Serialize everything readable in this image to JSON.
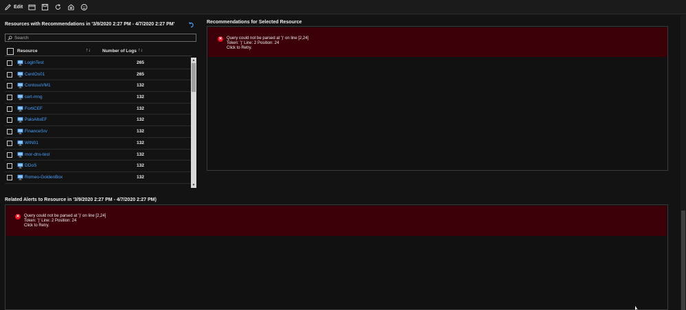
{
  "toolbar": {
    "edit_label": "Edit",
    "icons": [
      "edit-icon",
      "open-icon",
      "save-icon",
      "refresh-icon",
      "clone-icon",
      "feedback-icon"
    ]
  },
  "resources_panel": {
    "title": "Resources with Recommendations in '3/9/2020 2:27 PM - 4/7/2020 2:27 PM'",
    "search_placeholder": "Search",
    "columns": {
      "resource": "Resource",
      "logs": "Number of Logs"
    },
    "rows": [
      {
        "name": "LoginTest",
        "count": "265"
      },
      {
        "name": "CentOs01",
        "count": "265"
      },
      {
        "name": "ContosoVM1",
        "count": "132"
      },
      {
        "name": "cert-mng",
        "count": "132"
      },
      {
        "name": "FortiCEF",
        "count": "132"
      },
      {
        "name": "PaloAltoEF",
        "count": "132"
      },
      {
        "name": "FinanceSrv",
        "count": "132"
      },
      {
        "name": "WIN01",
        "count": "132"
      },
      {
        "name": "mor-dns-test",
        "count": "132"
      },
      {
        "name": "DDoS",
        "count": "132"
      },
      {
        "name": "Romeo-GoldenBox",
        "count": "132"
      }
    ]
  },
  "recommendations_panel": {
    "title": "Recommendations for Selected Resource",
    "error": {
      "line1": "Query could not be parsed at ')' on line [2,24]",
      "line2": "Token: ')' Line: 2 Position: 24",
      "line3": "Click to Retry."
    }
  },
  "alerts_panel": {
    "title": "Related Alerts to Resource in '3/9/2020 2:27 PM - 4/7/2020 2:27 PM)",
    "error": {
      "line1": "Query could not be parsed at ')' on line [2,24]",
      "line2": "Token: ')' Line: 2 Position: 24",
      "line3": "Click to Retry."
    }
  },
  "colors": {
    "link": "#4aa0ff",
    "error_bg": "#3b0008",
    "error_icon": "#e81123"
  }
}
